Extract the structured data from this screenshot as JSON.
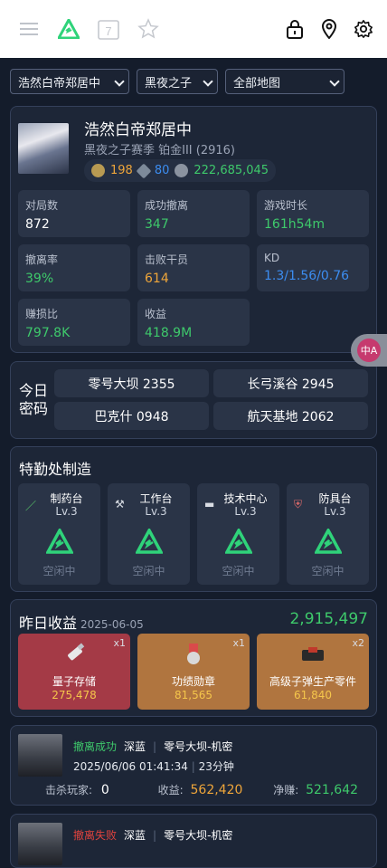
{
  "topbar": {
    "icons": [
      "menu-icon",
      "app-logo-icon",
      "calendar-icon",
      "star-icon",
      "lock-icon",
      "location-icon",
      "settings-icon"
    ],
    "calendar_day": "7"
  },
  "filters": {
    "player": "浩然白帝郑居中",
    "season": "黑夜之子",
    "map": "全部地图"
  },
  "profile": {
    "name": "浩然白帝郑居中",
    "season_rank": "黑夜之子赛季  铂金III (2916)",
    "currency": {
      "gold": "198",
      "voucher": "80",
      "coin": "222,685,045"
    },
    "stats": [
      {
        "label": "对局数",
        "value": "872",
        "color": "white"
      },
      {
        "label": "成功撤离",
        "value": "347",
        "color": "green"
      },
      {
        "label": "游戏时长",
        "value": "161h54m",
        "color": "green"
      },
      {
        "label": "撤离率",
        "value": "39%",
        "color": "green"
      },
      {
        "label": "击败干员",
        "value": "614",
        "color": "orange"
      },
      {
        "label": "KD",
        "value": "1.3/1.56/0.76",
        "color": "blue"
      },
      {
        "label": "赚损比",
        "value": "797.8K",
        "color": "green"
      },
      {
        "label": "收益",
        "value": "418.9M",
        "color": "green"
      }
    ]
  },
  "codes": {
    "label": "今日密码",
    "items": [
      "零号大坝 2355",
      "长弓溪谷 2945",
      "巴克什 0948",
      "航天基地 2062"
    ]
  },
  "craft": {
    "title": "特勤处制造",
    "stations": [
      {
        "name": "制药台",
        "level": "Lv.3",
        "status": "空闲中",
        "icon": "syringe-icon"
      },
      {
        "name": "工作台",
        "level": "Lv.3",
        "status": "空闲中",
        "icon": "tools-icon"
      },
      {
        "name": "技术中心",
        "level": "Lv.3",
        "status": "空闲中",
        "icon": "computer-icon"
      },
      {
        "name": "防具台",
        "level": "Lv.3",
        "status": "空闲中",
        "icon": "shield-icon"
      }
    ]
  },
  "yesterday": {
    "title": "昨日收益",
    "date": "2025-06-05",
    "total": "2,915,497",
    "items": [
      {
        "name": "量子存储",
        "price": "275,478",
        "count": "x1",
        "bg": "#a43a46"
      },
      {
        "name": "功绩勋章",
        "price": "81,565",
        "count": "x1",
        "bg": "#b0753f"
      },
      {
        "name": "高级子弹生产零件",
        "price": "61,840",
        "count": "x2",
        "bg": "#b0753f"
      }
    ]
  },
  "records": [
    {
      "status": "撤离成功",
      "mode": "深蓝",
      "map": "零号大坝-机密",
      "time": "2025/06/06 01:41:34",
      "duration": "23分钟",
      "kills_label": "击杀玩家:",
      "kills": "0",
      "income_label": "收益:",
      "income": "562,420",
      "net_label": "净赚:",
      "net": "521,642"
    },
    {
      "status": "撤离失败",
      "mode": "深蓝",
      "map": "零号大坝-机密"
    }
  ],
  "float_badge": "中A"
}
